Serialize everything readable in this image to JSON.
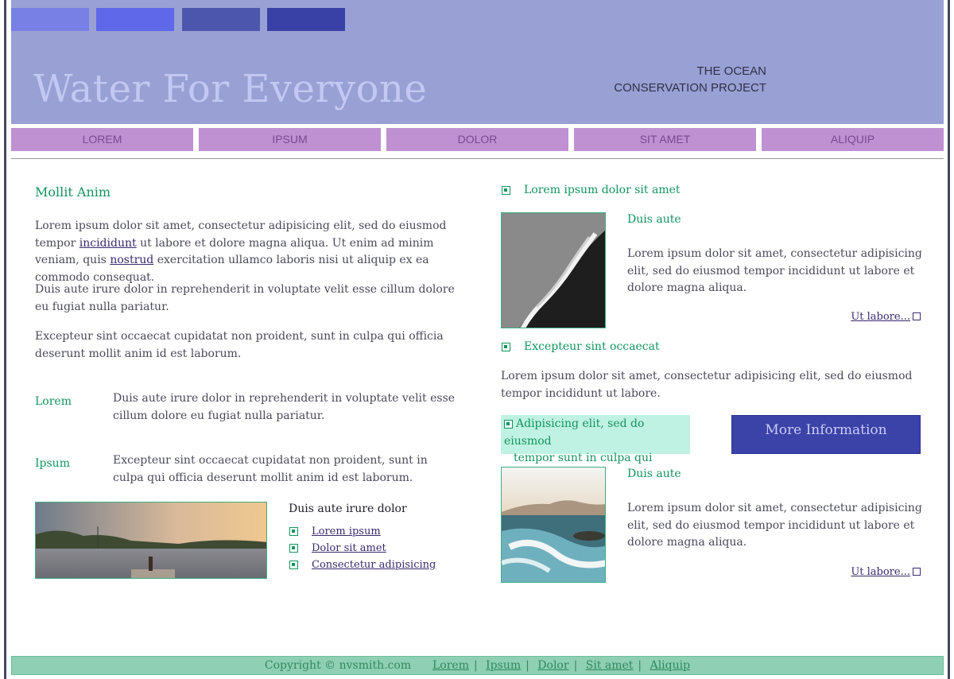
{
  "header": {
    "swatches": [
      "#7880e6",
      "#5e68e8",
      "#4d56ad",
      "#3a41a6"
    ],
    "title": "Water For Everyone",
    "tagline_line1": "THE OCEAN",
    "tagline_line2": "CONSERVATION PROJECT"
  },
  "nav": [
    "LOREM",
    "IPSUM",
    "DOLOR",
    "SIT AMET",
    "ALIQUIP"
  ],
  "left": {
    "heading": "Mollit Anim",
    "p1_a": "Lorem ipsum dolor sit amet, consectetur adipisicing elit, sed do eiusmod tempor",
    "p1_link1": "incididunt",
    "p1_b": "ut labore et dolore magna aliqua. Ut enim ad minim veniam, quis",
    "p1_link2": "nostrud",
    "p1_c": "exercitation ullamco laboris nisi ut aliquip ex ea commodo consequat.",
    "p2": "Duis aute irure dolor in reprehenderit in voluptate velit esse cillum dolore eu fugiat nulla pariatur.",
    "p3": "Excepteur sint occaecat cupidatat non proident, sunt in culpa qui officia deserunt mollit anim id est laborum.",
    "defs": [
      {
        "term": "Lorem",
        "desc": "Duis aute irure dolor in reprehenderit in voluptate velit esse cillum dolore eu fugiat nulla pariatur."
      },
      {
        "term": "Ipsum",
        "desc": "Excepteur sint occaecat cupidatat non proident, sunt in culpa qui officia deserunt mollit anim id est laborum."
      }
    ],
    "links_title": "Duis aute irure dolor",
    "links": [
      "Lorem ipsum",
      "Dolor sit amet",
      "Consectetur adipisicing"
    ]
  },
  "right": {
    "item1_heading": "Lorem ipsum dolor sit amet",
    "item1_sub": "Duis aute",
    "item1_text": "Lorem ipsum dolor sit amet, consectetur adipisicing elit, sed do eiusmod tempor incididunt ut labore et dolore magna aliqua.",
    "item1_more": "Ut labore...",
    "item2_heading": "Excepteur sint occaecat",
    "item2_text": "Lorem ipsum dolor sit amet, consectetur adipisicing elit, sed do eiusmod tempor incididunt ut labore.",
    "callout_line1": "Adipisicing elit, sed do eiusmod",
    "callout_line2": "tempor sunt in culpa qui officia.",
    "more_button": "More Information",
    "item3_sub": "Duis aute",
    "item3_text": "Lorem ipsum dolor sit amet, consectetur adipisicing elit, sed do eiusmod tempor incididunt ut labore et dolore magna aliqua.",
    "item3_more": "Ut labore..."
  },
  "footer": {
    "copyright": "Copyright © nvsmith.com",
    "links": [
      "Lorem",
      "Ipsum",
      "Dolor",
      "Sit amet",
      "Aliquip"
    ]
  }
}
